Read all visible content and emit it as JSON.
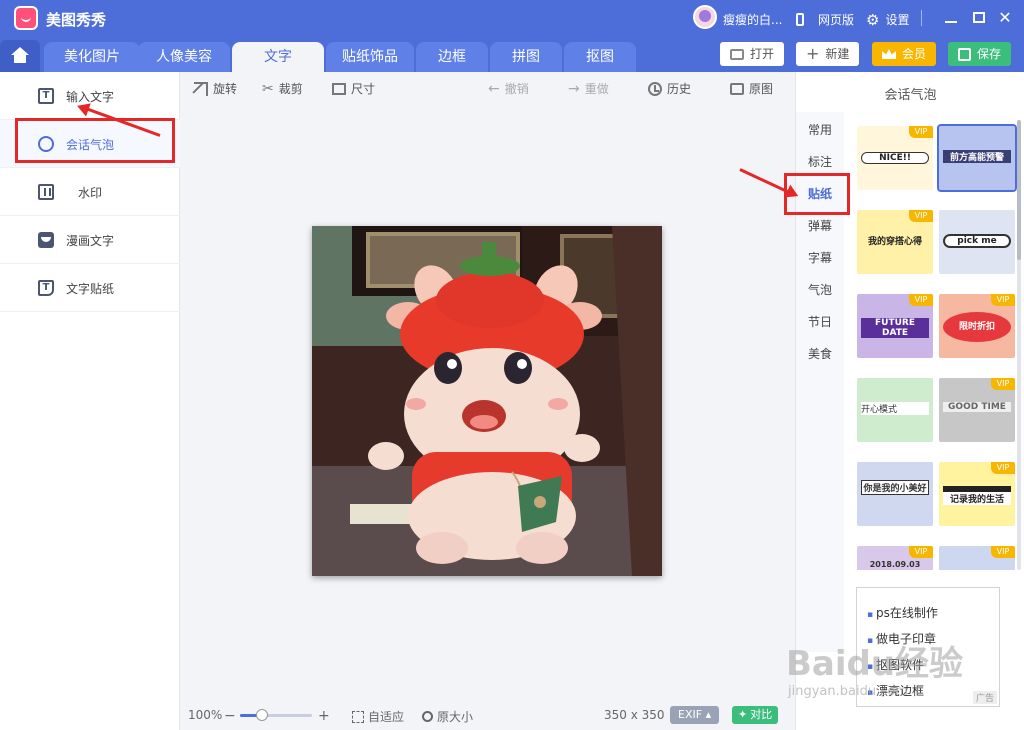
{
  "app": {
    "title": "美图秀秀",
    "user_name": "瘦瘦的白...",
    "web_version": "网页版",
    "settings": "设置"
  },
  "tabs": {
    "beautify": "美化图片",
    "portrait": "人像美容",
    "text": "文字",
    "sticker": "贴纸饰品",
    "border": "边框",
    "collage": "拼图",
    "cutout": "抠图"
  },
  "topbuttons": {
    "open": "打开",
    "new": "新建",
    "vip": "会员",
    "save": "保存"
  },
  "left": {
    "items": [
      "输入文字",
      "会话气泡",
      "水印",
      "漫画文字",
      "文字贴纸"
    ]
  },
  "toolbar": {
    "rotate": "旋转",
    "crop": "裁剪",
    "size": "尺寸",
    "undo": "撤销",
    "redo": "重做",
    "history": "历史",
    "original": "原图"
  },
  "right": {
    "title": "会话气泡",
    "categories": [
      "常用",
      "标注",
      "贴纸",
      "弹幕",
      "字幕",
      "气泡",
      "节日",
      "美食"
    ],
    "vip_label": "VIP",
    "stickers": [
      "NICE!!",
      "前方高能预警",
      "我的穿搭心得",
      "pick me",
      "FUTURE DATE",
      "限时折扣",
      "开心模式",
      "GOOD TIME",
      "你是我的小美好",
      "记录我的生活",
      "2018.09.03",
      ""
    ]
  },
  "bottom": {
    "zoom": "100%",
    "zoom_level": 0.3,
    "fit": "自适应",
    "original_size": "原大小",
    "dimensions": "350 x 350",
    "exif": "EXIF",
    "compare": "对比"
  },
  "ad": {
    "links": [
      "ps在线制作",
      "做电子印章",
      "抠图软件",
      "漂亮边框"
    ],
    "tag": "广告"
  },
  "watermark": {
    "main": "Baidu经验",
    "sub": "jingyan.baidu.com"
  }
}
